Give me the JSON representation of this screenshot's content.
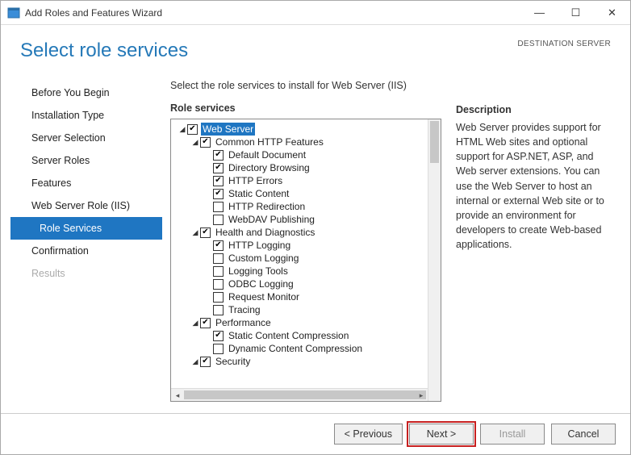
{
  "window": {
    "title": "Add Roles and Features Wizard"
  },
  "header": {
    "page_title": "Select role services",
    "destination_label": "DESTINATION SERVER"
  },
  "instruction": "Select the role services to install for Web Server (IIS)",
  "nav": {
    "items": [
      {
        "label": "Before You Begin",
        "kind": "item"
      },
      {
        "label": "Installation Type",
        "kind": "item"
      },
      {
        "label": "Server Selection",
        "kind": "item"
      },
      {
        "label": "Server Roles",
        "kind": "item"
      },
      {
        "label": "Features",
        "kind": "item"
      },
      {
        "label": "Web Server Role (IIS)",
        "kind": "item"
      },
      {
        "label": "Role Services",
        "kind": "sub-selected"
      },
      {
        "label": "Confirmation",
        "kind": "item"
      },
      {
        "label": "Results",
        "kind": "dim"
      }
    ]
  },
  "role_services_label": "Role services",
  "tree": [
    {
      "indent": 0,
      "caret": "open",
      "checked": true,
      "label": "Web Server",
      "highlight": true
    },
    {
      "indent": 1,
      "caret": "open",
      "checked": true,
      "label": "Common HTTP Features"
    },
    {
      "indent": 2,
      "caret": "none",
      "checked": true,
      "label": "Default Document"
    },
    {
      "indent": 2,
      "caret": "none",
      "checked": true,
      "label": "Directory Browsing"
    },
    {
      "indent": 2,
      "caret": "none",
      "checked": true,
      "label": "HTTP Errors"
    },
    {
      "indent": 2,
      "caret": "none",
      "checked": true,
      "label": "Static Content"
    },
    {
      "indent": 2,
      "caret": "none",
      "checked": false,
      "label": "HTTP Redirection"
    },
    {
      "indent": 2,
      "caret": "none",
      "checked": false,
      "label": "WebDAV Publishing"
    },
    {
      "indent": 1,
      "caret": "open",
      "checked": true,
      "label": "Health and Diagnostics"
    },
    {
      "indent": 2,
      "caret": "none",
      "checked": true,
      "label": "HTTP Logging"
    },
    {
      "indent": 2,
      "caret": "none",
      "checked": false,
      "label": "Custom Logging"
    },
    {
      "indent": 2,
      "caret": "none",
      "checked": false,
      "label": "Logging Tools"
    },
    {
      "indent": 2,
      "caret": "none",
      "checked": false,
      "label": "ODBC Logging"
    },
    {
      "indent": 2,
      "caret": "none",
      "checked": false,
      "label": "Request Monitor"
    },
    {
      "indent": 2,
      "caret": "none",
      "checked": false,
      "label": "Tracing"
    },
    {
      "indent": 1,
      "caret": "open",
      "checked": true,
      "label": "Performance"
    },
    {
      "indent": 2,
      "caret": "none",
      "checked": true,
      "label": "Static Content Compression"
    },
    {
      "indent": 2,
      "caret": "none",
      "checked": false,
      "label": "Dynamic Content Compression"
    },
    {
      "indent": 1,
      "caret": "open",
      "checked": true,
      "label": "Security"
    }
  ],
  "description": {
    "label": "Description",
    "text": "Web Server provides support for HTML Web sites and optional support for ASP.NET, ASP, and Web server extensions. You can use the Web Server to host an internal or external Web site or to provide an environment for developers to create Web-based applications."
  },
  "buttons": {
    "previous": "< Previous",
    "next": "Next >",
    "install": "Install",
    "cancel": "Cancel"
  }
}
